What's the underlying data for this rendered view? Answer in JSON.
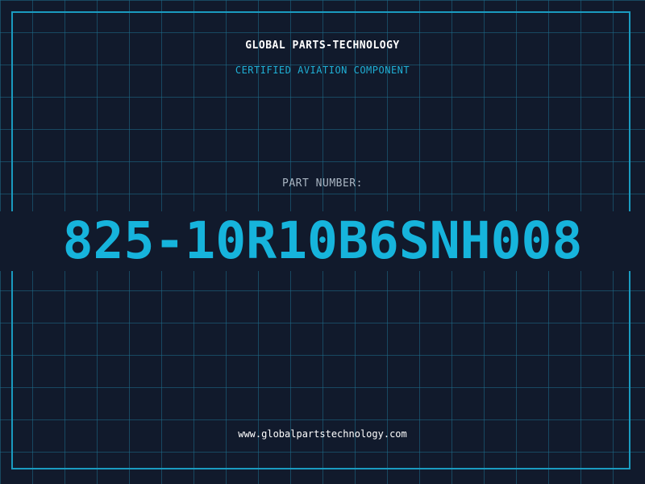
{
  "header": {
    "company": "GLOBAL PARTS-TECHNOLOGY",
    "tagline": "CERTIFIED AVIATION COMPONENT"
  },
  "part": {
    "label": "PART NUMBER:",
    "number": "825-10R10B6SNH008"
  },
  "footer": {
    "website": "www.globalpartstechnology.com"
  },
  "colors": {
    "background": "#111a2c",
    "grid": "#1e6e8c",
    "accent": "#16b4dc",
    "frame": "#1a9bc0"
  }
}
